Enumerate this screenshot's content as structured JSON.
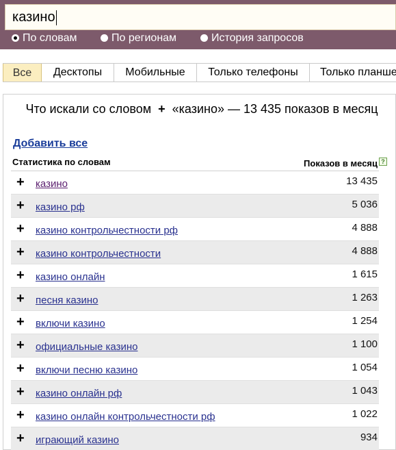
{
  "search": {
    "value": "казино"
  },
  "modes": [
    {
      "label": "По словам",
      "checked": true
    },
    {
      "label": "По регионам",
      "checked": false
    },
    {
      "label": "История запросов",
      "checked": false
    }
  ],
  "tabs": [
    {
      "label": "Все",
      "active": true
    },
    {
      "label": "Десктопы",
      "active": false
    },
    {
      "label": "Мобильные",
      "active": false
    },
    {
      "label": "Только телефоны",
      "active": false
    },
    {
      "label": "Только планше",
      "active": false
    }
  ],
  "panel": {
    "title_prefix": "Что искали со словом",
    "title_suffix": "«казино» — 13 435 показов в месяц",
    "add_all": "Добавить все",
    "col_left": "Статистика по словам",
    "col_right": "Показов в месяц",
    "help_glyph": "?"
  },
  "rows": [
    {
      "plus": "+",
      "phrase": "казино",
      "count": "13 435",
      "visited": true
    },
    {
      "plus": "+",
      "phrase": "казино рф",
      "count": "5 036"
    },
    {
      "plus": "+",
      "phrase": "казино контрольчестности рф",
      "count": "4 888"
    },
    {
      "plus": "+",
      "phrase": "казино контрольчестности",
      "count": "4 888"
    },
    {
      "plus": "+",
      "phrase": "казино онлайн",
      "count": "1 615"
    },
    {
      "plus": "+",
      "phrase": "песня казино",
      "count": "1 263"
    },
    {
      "plus": "+",
      "phrase": "включи казино",
      "count": "1 254"
    },
    {
      "plus": "+",
      "phrase": "официальные казино",
      "count": "1 100"
    },
    {
      "plus": "+",
      "phrase": "включи песню казино",
      "count": "1 054"
    },
    {
      "plus": "+",
      "phrase": "казино онлайн рф",
      "count": "1 043"
    },
    {
      "plus": "+",
      "phrase": "казино онлайн контрольчестности рф",
      "count": "1 022"
    },
    {
      "plus": "+",
      "phrase": "играющий казино",
      "count": "934"
    }
  ]
}
